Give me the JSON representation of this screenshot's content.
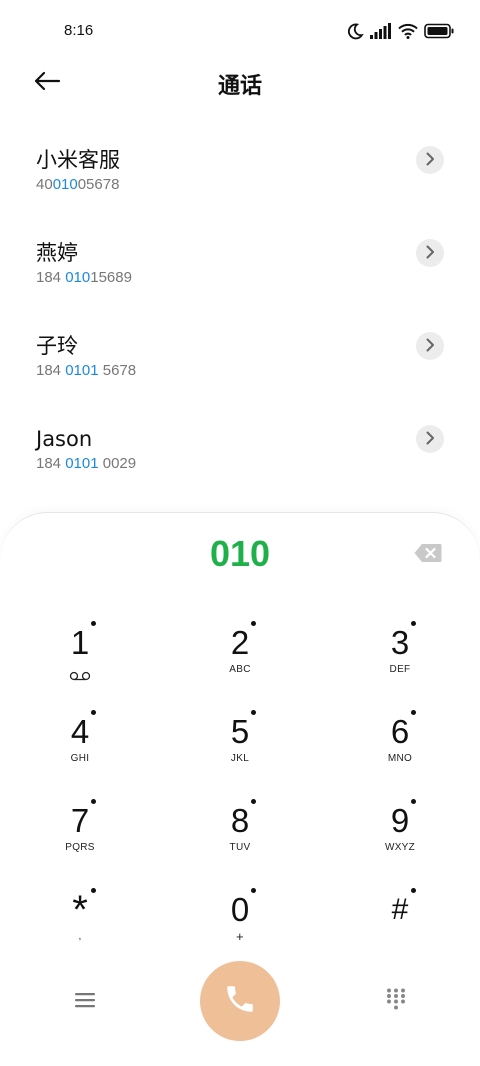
{
  "status_bar": {
    "time": "8:16",
    "icons": [
      "moon-icon",
      "signal-icon",
      "wifi-icon",
      "battery-icon"
    ]
  },
  "header": {
    "title": "通话",
    "back_icon": "arrow-left-icon"
  },
  "contacts": [
    {
      "name": "小米客服",
      "number_parts": [
        "40",
        "010",
        "05678"
      ]
    },
    {
      "name": "燕婷",
      "number_parts": [
        "184 ",
        "010",
        "15689"
      ]
    },
    {
      "name": "子玲",
      "number_parts": [
        "184 ",
        "0101",
        " 5678"
      ]
    },
    {
      "name": "Jason",
      "number_parts": [
        "184 ",
        "0101",
        " 0029"
      ]
    }
  ],
  "dialer": {
    "input_value": "010",
    "keys": [
      {
        "digit": "1",
        "letters": ""
      },
      {
        "digit": "2",
        "letters": "ABC"
      },
      {
        "digit": "3",
        "letters": "DEF"
      },
      {
        "digit": "4",
        "letters": "GHI"
      },
      {
        "digit": "5",
        "letters": "JKL"
      },
      {
        "digit": "6",
        "letters": "MNO"
      },
      {
        "digit": "7",
        "letters": "PQRS"
      },
      {
        "digit": "8",
        "letters": "TUV"
      },
      {
        "digit": "9",
        "letters": "WXYZ"
      },
      {
        "digit": "*",
        "letters": ","
      },
      {
        "digit": "0",
        "letters": "+"
      },
      {
        "digit": "#",
        "letters": ""
      }
    ]
  },
  "colors": {
    "highlight": "#1a8ae0",
    "dial_input": "#20b04a",
    "call_button": "#efbf98"
  }
}
